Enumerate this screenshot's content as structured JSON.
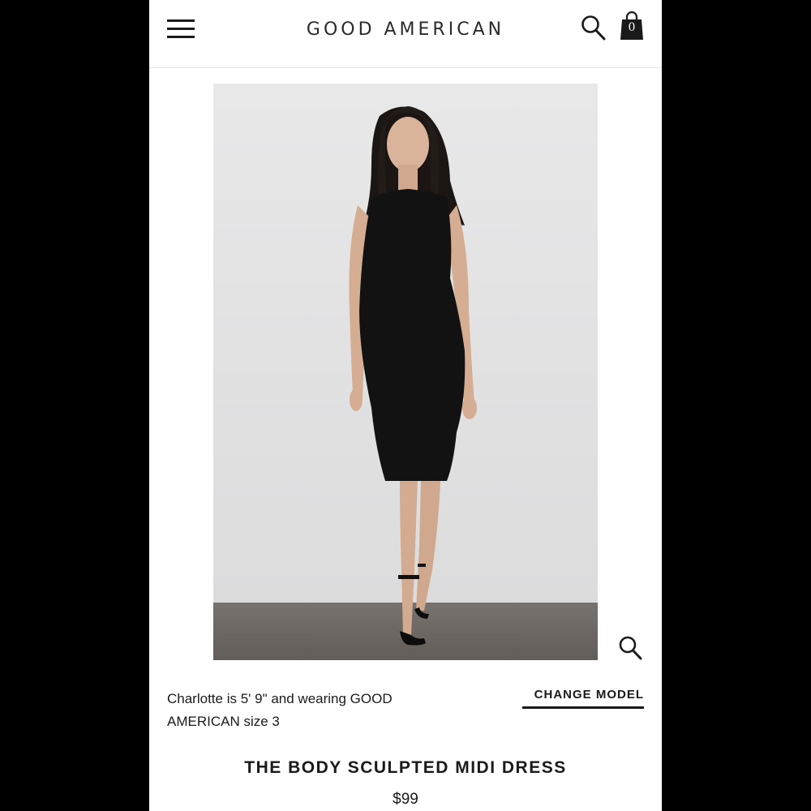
{
  "header": {
    "brand": "GOOD AMERICAN",
    "menu_icon": "hamburger-menu-icon",
    "search_icon": "search-icon",
    "bag_icon": "shopping-bag-icon",
    "bag_count": "0"
  },
  "product": {
    "image_desc_icon": "product-photo",
    "zoom_icon": "zoom-icon",
    "model_info": "Charlotte is 5' 9\" and wearing GOOD AMERICAN size 3",
    "change_model_label": "CHANGE MODEL",
    "name": "THE BODY SCULPTED MIDI DRESS",
    "price": "$99"
  },
  "colors": {
    "text": "#1a1a1a",
    "backdrop": "#e6e6e6",
    "floor": "#6b6662",
    "dress": "#121212"
  }
}
